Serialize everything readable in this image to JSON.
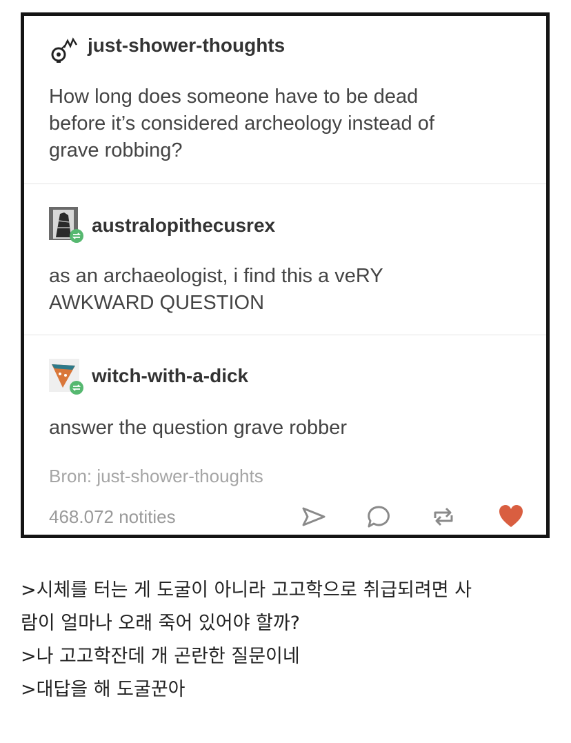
{
  "posts": [
    {
      "username": "just-shower-thoughts",
      "text": "How long does someone have to be dead\nbefore it’s considered archeology instead of\ngrave robbing?"
    },
    {
      "username": "australopithecusrex",
      "text": "as an archaeologist, i find this a veRY\nAWKWARD QUESTION"
    },
    {
      "username": "witch-with-a-dick",
      "text": "answer the question grave robber"
    }
  ],
  "footer": {
    "source": "Bron: just-shower-thoughts",
    "notes": "468.072 notities"
  },
  "icons": {
    "share": "paper-plane-icon",
    "reply": "speech-bubble-icon",
    "reblog": "reblog-icon",
    "like": "heart-icon"
  },
  "colors": {
    "like": "#d95e40",
    "reblog_badge": "#56b870",
    "frame": "#141414"
  },
  "caption": [
    ">시체를 터는 게 도굴이 아니라 고고학으로 취급되려면 사",
    "람이 얼마나 오래 죽어 있어야 할까?",
    ">나 고고학잔데 개 곤란한 질문이네",
    ">대답을 해 도굴꾼아"
  ]
}
